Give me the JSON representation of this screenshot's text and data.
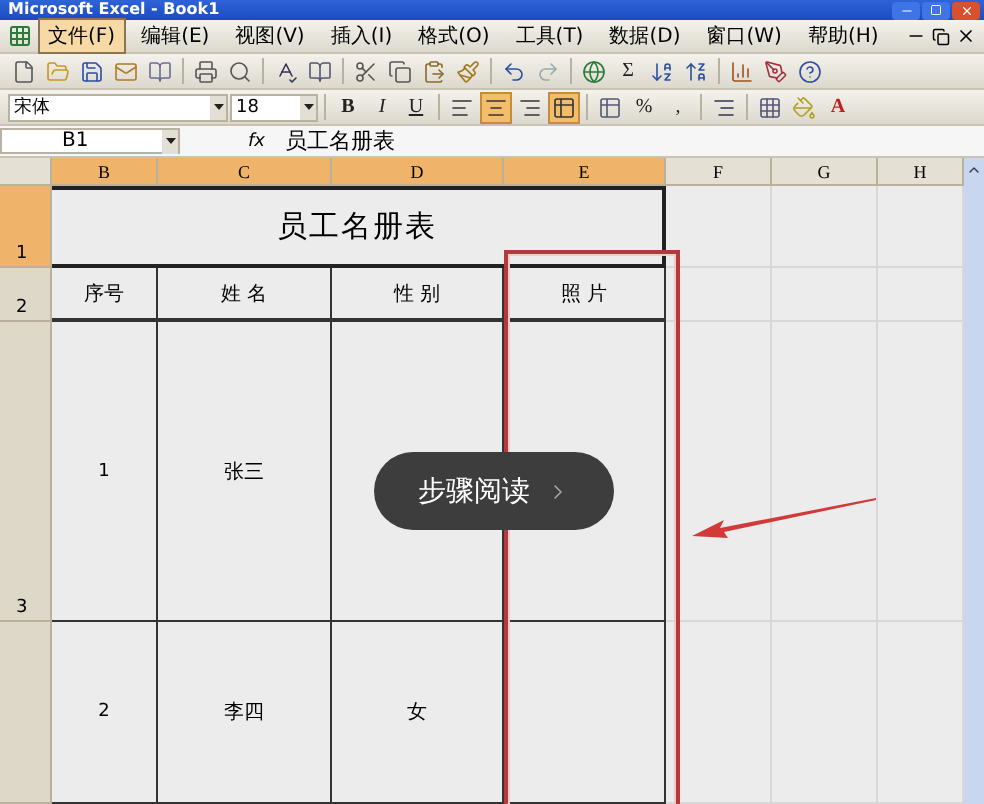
{
  "window": {
    "title": "Microsoft Excel - Book1"
  },
  "menu_bar": {
    "items": [
      {
        "label": "文件(F)",
        "selected": true
      },
      {
        "label": "编辑(E)",
        "selected": false
      },
      {
        "label": "视图(V)",
        "selected": false
      },
      {
        "label": "插入(I)",
        "selected": false
      },
      {
        "label": "格式(O)",
        "selected": false
      },
      {
        "label": "工具(T)",
        "selected": false
      },
      {
        "label": "数据(D)",
        "selected": false
      },
      {
        "label": "窗口(W)",
        "selected": false
      },
      {
        "label": "帮助(H)",
        "selected": false
      }
    ]
  },
  "standard_toolbar": {
    "sum_label": "Σ"
  },
  "format_toolbar": {
    "font": "宋体",
    "size": "18",
    "style_buttons": [
      {
        "label": "B",
        "kind": "bold"
      },
      {
        "label": "I",
        "kind": "italic"
      },
      {
        "label": "U",
        "kind": "underline"
      }
    ],
    "align_buttons": [
      {
        "kind": "left",
        "selected": false
      },
      {
        "kind": "center",
        "selected": true
      },
      {
        "kind": "right",
        "selected": false
      },
      {
        "kind": "merge",
        "selected": true
      }
    ],
    "number_buttons": [
      "%",
      ","
    ],
    "font_color": "A"
  },
  "formula_bar": {
    "name_box": "B1",
    "fx": "fx",
    "formula": "员工名册表"
  },
  "sheet": {
    "columns": [
      {
        "label": "B",
        "selected": true
      },
      {
        "label": "C",
        "selected": true
      },
      {
        "label": "D",
        "selected": true
      },
      {
        "label": "E",
        "selected": true
      },
      {
        "label": "F",
        "selected": false
      },
      {
        "label": "G",
        "selected": false
      },
      {
        "label": "H",
        "selected": false
      }
    ],
    "rows": [
      {
        "label": "1",
        "selected": true
      },
      {
        "label": "2",
        "selected": false
      },
      {
        "label": "3",
        "selected": false
      }
    ]
  },
  "table": {
    "title": "员工名册表",
    "header": [
      "序号",
      "姓 名",
      "性 别",
      "照 片"
    ],
    "rows": [
      {
        "number": "1",
        "name": "张三"
      },
      {
        "number": "2",
        "name": "李四",
        "gender": "女"
      }
    ]
  },
  "overlay_button": {
    "label": "步骤阅读"
  }
}
